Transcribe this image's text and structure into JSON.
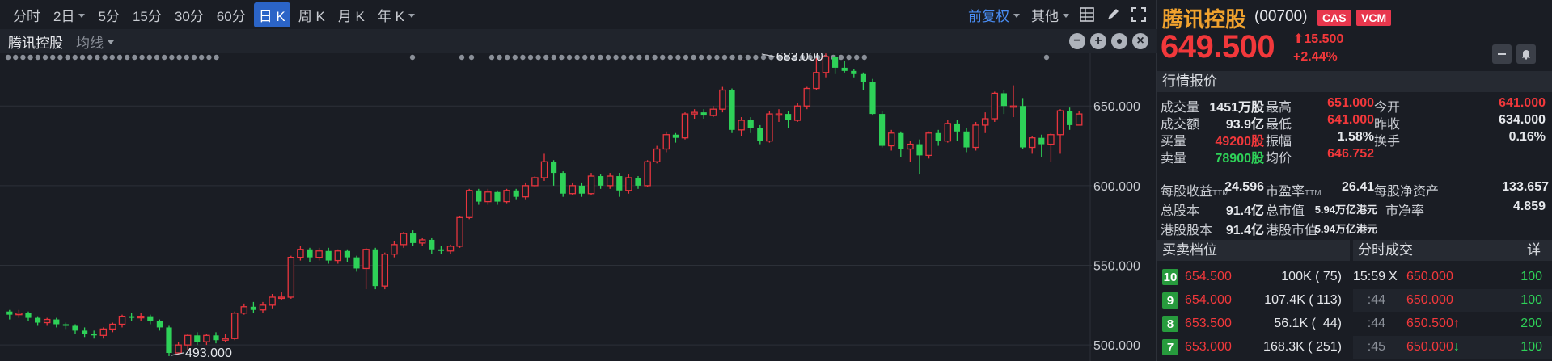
{
  "toolbar": {
    "periods": [
      {
        "label": "分时",
        "caret": false,
        "active": false
      },
      {
        "label": "2日",
        "caret": true,
        "active": false
      },
      {
        "label": "5分",
        "caret": false,
        "active": false
      },
      {
        "label": "15分",
        "caret": false,
        "active": false
      },
      {
        "label": "30分",
        "caret": false,
        "active": false
      },
      {
        "label": "60分",
        "caret": false,
        "active": false
      },
      {
        "label": "日 K",
        "caret": false,
        "active": true
      },
      {
        "label": "周 K",
        "caret": false,
        "active": false
      },
      {
        "label": "月 K",
        "caret": false,
        "active": false
      },
      {
        "label": "年 K",
        "caret": true,
        "active": false
      }
    ],
    "adjust_label": "前复权",
    "other_label": "其他"
  },
  "subbar": {
    "title": "腾讯控股",
    "ma_label": "均线"
  },
  "chart_data": {
    "type": "candlestick",
    "ylim": [
      495,
      678
    ],
    "yticks": [
      "650.000",
      "600.000",
      "550.000",
      "500.000"
    ],
    "ytick_values": [
      650,
      600,
      550,
      500
    ],
    "high_annotation": {
      "label": "683.000",
      "value": 683,
      "index": 80
    },
    "low_annotation": {
      "label": "493.000",
      "value": 493,
      "index": 17
    },
    "up_color": "#e8353e",
    "down_color": "#2ed158",
    "candles": [
      [
        521,
        519,
        522,
        516
      ],
      [
        519,
        520,
        522,
        517
      ],
      [
        520,
        517,
        521,
        515
      ],
      [
        517,
        514,
        518,
        512
      ],
      [
        514,
        516,
        517,
        512
      ],
      [
        516,
        513,
        517,
        511
      ],
      [
        513,
        512,
        514,
        510
      ],
      [
        512,
        509,
        513,
        507
      ],
      [
        509,
        507,
        511,
        505
      ],
      [
        507,
        506,
        509,
        504
      ],
      [
        506,
        510,
        511,
        504
      ],
      [
        510,
        513,
        514,
        508
      ],
      [
        513,
        518,
        519,
        511
      ],
      [
        518,
        517,
        520,
        515
      ],
      [
        517,
        518,
        520,
        515
      ],
      [
        518,
        515,
        519,
        513
      ],
      [
        515,
        511,
        516,
        509
      ],
      [
        511,
        495,
        512,
        493
      ],
      [
        495,
        500,
        502,
        494
      ],
      [
        500,
        506,
        507,
        497
      ],
      [
        506,
        502,
        508,
        500
      ],
      [
        502,
        506,
        507,
        500
      ],
      [
        506,
        503,
        508,
        501
      ],
      [
        503,
        504,
        507,
        502
      ],
      [
        504,
        520,
        521,
        503
      ],
      [
        520,
        524,
        526,
        519
      ],
      [
        524,
        522,
        527,
        520
      ],
      [
        522,
        525,
        527,
        520
      ],
      [
        525,
        530,
        532,
        523
      ],
      [
        530,
        530,
        533,
        528
      ],
      [
        530,
        555,
        556,
        529
      ],
      [
        555,
        560,
        562,
        553
      ],
      [
        560,
        555,
        561,
        552
      ],
      [
        555,
        559,
        561,
        553
      ],
      [
        559,
        553,
        561,
        551
      ],
      [
        553,
        559,
        560,
        551
      ],
      [
        559,
        555,
        560,
        552
      ],
      [
        555,
        548,
        556,
        546
      ],
      [
        548,
        560,
        561,
        535
      ],
      [
        560,
        537,
        561,
        535
      ],
      [
        537,
        557,
        558,
        535
      ],
      [
        557,
        563,
        565,
        555
      ],
      [
        563,
        570,
        571,
        561
      ],
      [
        570,
        564,
        572,
        562
      ],
      [
        564,
        566,
        567,
        562
      ],
      [
        566,
        560,
        567,
        557
      ],
      [
        560,
        559,
        562,
        557
      ],
      [
        559,
        562,
        563,
        557
      ],
      [
        562,
        580,
        581,
        561
      ],
      [
        580,
        597,
        598,
        579
      ],
      [
        597,
        590,
        598,
        588
      ],
      [
        590,
        596,
        598,
        588
      ],
      [
        596,
        590,
        597,
        588
      ],
      [
        590,
        597,
        598,
        589
      ],
      [
        597,
        593,
        598,
        591
      ],
      [
        593,
        600,
        602,
        591
      ],
      [
        600,
        605,
        606,
        599
      ],
      [
        605,
        615,
        620,
        603
      ],
      [
        615,
        608,
        616,
        600
      ],
      [
        608,
        595,
        609,
        593
      ],
      [
        595,
        600,
        602,
        594
      ],
      [
        600,
        595,
        602,
        593
      ],
      [
        595,
        606,
        608,
        594
      ],
      [
        606,
        600,
        607,
        598
      ],
      [
        600,
        606,
        608,
        598
      ],
      [
        606,
        597,
        608,
        593
      ],
      [
        597,
        605,
        607,
        595
      ],
      [
        605,
        600,
        606,
        598
      ],
      [
        600,
        615,
        616,
        599
      ],
      [
        615,
        623,
        625,
        614
      ],
      [
        623,
        632,
        634,
        621
      ],
      [
        632,
        630,
        633,
        627
      ],
      [
        630,
        645,
        646,
        629
      ],
      [
        645,
        646,
        648,
        642
      ],
      [
        646,
        644,
        648,
        642
      ],
      [
        644,
        648,
        650,
        643
      ],
      [
        648,
        660,
        662,
        646
      ],
      [
        660,
        635,
        661,
        633
      ],
      [
        635,
        641,
        643,
        631
      ],
      [
        641,
        636,
        643,
        633
      ],
      [
        636,
        628,
        638,
        626
      ],
      [
        628,
        645,
        647,
        627
      ],
      [
        645,
        645,
        648,
        640
      ],
      [
        645,
        641,
        647,
        636
      ],
      [
        641,
        650,
        652,
        640
      ],
      [
        650,
        661,
        662,
        648
      ],
      [
        661,
        671,
        680,
        660
      ],
      [
        671,
        681,
        683,
        668
      ],
      [
        681,
        674,
        682,
        670
      ],
      [
        674,
        672,
        678,
        671
      ],
      [
        672,
        670,
        673,
        668
      ],
      [
        670,
        665,
        671,
        660
      ],
      [
        665,
        645,
        667,
        644
      ],
      [
        645,
        625,
        647,
        624
      ],
      [
        625,
        633,
        635,
        622
      ],
      [
        633,
        623,
        634,
        618
      ],
      [
        623,
        626,
        628,
        615
      ],
      [
        626,
        619,
        629,
        607
      ],
      [
        619,
        633,
        634,
        617
      ],
      [
        633,
        628,
        635,
        625
      ],
      [
        628,
        639,
        641,
        627
      ],
      [
        639,
        634,
        641,
        628
      ],
      [
        634,
        624,
        636,
        621
      ],
      [
        624,
        638,
        640,
        622
      ],
      [
        638,
        642,
        646,
        633
      ],
      [
        642,
        658,
        659,
        640
      ],
      [
        658,
        650,
        660,
        645
      ],
      [
        650,
        650,
        663,
        643
      ],
      [
        650,
        624,
        655,
        623
      ],
      [
        624,
        630,
        631,
        620
      ],
      [
        630,
        626,
        632,
        618
      ],
      [
        626,
        632,
        633,
        615
      ],
      [
        632,
        647,
        648,
        620
      ],
      [
        647,
        638,
        649,
        635
      ],
      [
        638,
        645,
        647,
        640
      ]
    ]
  },
  "quote": {
    "name": "腾讯控股",
    "code": "(00700)",
    "tags": [
      "CAS",
      "VCM"
    ],
    "price": "649.500",
    "change": "15.500",
    "change_pct": "+2.44%"
  },
  "market_section": {
    "title": "行情报价",
    "rows1": [
      [
        {
          "label": "成交量",
          "value": "1451万股",
          "color": "w"
        },
        {
          "label": "最高",
          "value": "651.000",
          "color": "r"
        },
        {
          "label": "今开",
          "value": "641.000",
          "color": "r"
        }
      ],
      [
        {
          "label": "成交额",
          "value": "93.9亿",
          "color": "w"
        },
        {
          "label": "最低",
          "value": "641.000",
          "color": "r"
        },
        {
          "label": "昨收",
          "value": "634.000",
          "color": "w"
        }
      ],
      [
        {
          "label": "买量",
          "value": "49200股",
          "color": "r"
        },
        {
          "label": "振幅",
          "value": "1.58%",
          "color": "w"
        },
        {
          "label": "换手",
          "value": "0.16%",
          "color": "w"
        }
      ],
      [
        {
          "label": "卖量",
          "value": "78900股",
          "color": "g"
        },
        {
          "label": "均价",
          "value": "646.752",
          "color": "r"
        }
      ]
    ],
    "eps_label": "每股收益",
    "ttm": "TTM",
    "eps_value": "24.596",
    "pe_label": "市盈率",
    "pe_value": "26.41",
    "bvps_label": "每股净资产",
    "bvps_value": "133.657",
    "total_shares_label": "总股本",
    "total_shares_value": "91.4亿",
    "mcap_label": "总市值",
    "mcap_value": "5.94万亿港元",
    "pb_label": "市净率",
    "pb_value": "4.859",
    "hk_shares_label": "港股股本",
    "hk_shares_value": "91.4亿",
    "hk_mcap_label": "港股市值",
    "hk_mcap_value": "5.94万亿港元"
  },
  "order_book": {
    "title": "买卖档位",
    "rows": [
      {
        "level": "10",
        "price": "654.500",
        "vol": "100K ( 75)"
      },
      {
        "level": "9",
        "price": "654.000",
        "vol": "107.4K ( 113)"
      },
      {
        "level": "8",
        "price": "653.500",
        "vol": "56.1K (  44)"
      },
      {
        "level": "7",
        "price": "653.000",
        "vol": "168.3K ( 251)"
      }
    ]
  },
  "ticks": {
    "title": "分时成交",
    "detail_label": "详",
    "rows": [
      {
        "time": "15:59",
        "flag": "X",
        "price": "650.000",
        "vol": "100",
        "arrow": ""
      },
      {
        "time": ":44",
        "flag": "",
        "price": "650.000",
        "vol": "100",
        "arrow": ""
      },
      {
        "time": ":44",
        "flag": "",
        "price": "650.500",
        "vol": "200",
        "arrow": "up"
      },
      {
        "time": ":45",
        "flag": "",
        "price": "650.000",
        "vol": "100",
        "arrow": "down"
      }
    ]
  }
}
